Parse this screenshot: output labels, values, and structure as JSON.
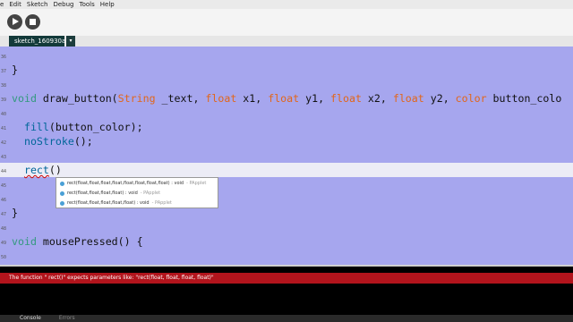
{
  "menu": [
    "e",
    "Edit",
    "Sketch",
    "Debug",
    "Tools",
    "Help"
  ],
  "toolbar": {
    "run_icon": "play-icon",
    "stop_icon": "stop-icon"
  },
  "tab": {
    "name": "sketch_160930a",
    "arrow": "▾"
  },
  "editor": {
    "line_numbers": [
      "36",
      "37",
      "38",
      "39",
      "40",
      "41",
      "42",
      "43",
      "44",
      "45",
      "46",
      "47",
      "48",
      "49",
      "50"
    ],
    "lines": {
      "l37": "}",
      "l39_kw": "void",
      "l39_fn": " draw_button(",
      "l39_t1": "String",
      "l39_p1": " _text, ",
      "l39_t2": "float",
      "l39_p2": " x1, ",
      "l39_t3": "float",
      "l39_p3": " y1, ",
      "l39_t4": "float",
      "l39_p4": " x2, ",
      "l39_t5": "float",
      "l39_p5": " y2, ",
      "l39_t6": "color",
      "l39_p6": " button_colo",
      "l41_fn": "fill",
      "l41_rest": "(button_color);",
      "l42_fn": "noStroke",
      "l42_rest": "();",
      "l44_fn": "rect",
      "l44_rest": "()",
      "l47": "}",
      "l49_kw": "void",
      "l49_fn": " mousePressed",
      "l49_rest": "() {"
    }
  },
  "autocomplete": {
    "items": [
      {
        "sig": "rect(float,float,float,float,float,float,float,float) : void",
        "cls": " - PApplet"
      },
      {
        "sig": "rect(float,float,float,float) : void",
        "cls": " - PApplet"
      },
      {
        "sig": "rect(float,float,float,float,float) : void",
        "cls": " - PApplet"
      }
    ]
  },
  "status": {
    "message": "The function \" rect()\" expects parameters like: \"rect(float, float, float, float)\""
  },
  "bottom_tabs": [
    "Console",
    "Errors"
  ]
}
